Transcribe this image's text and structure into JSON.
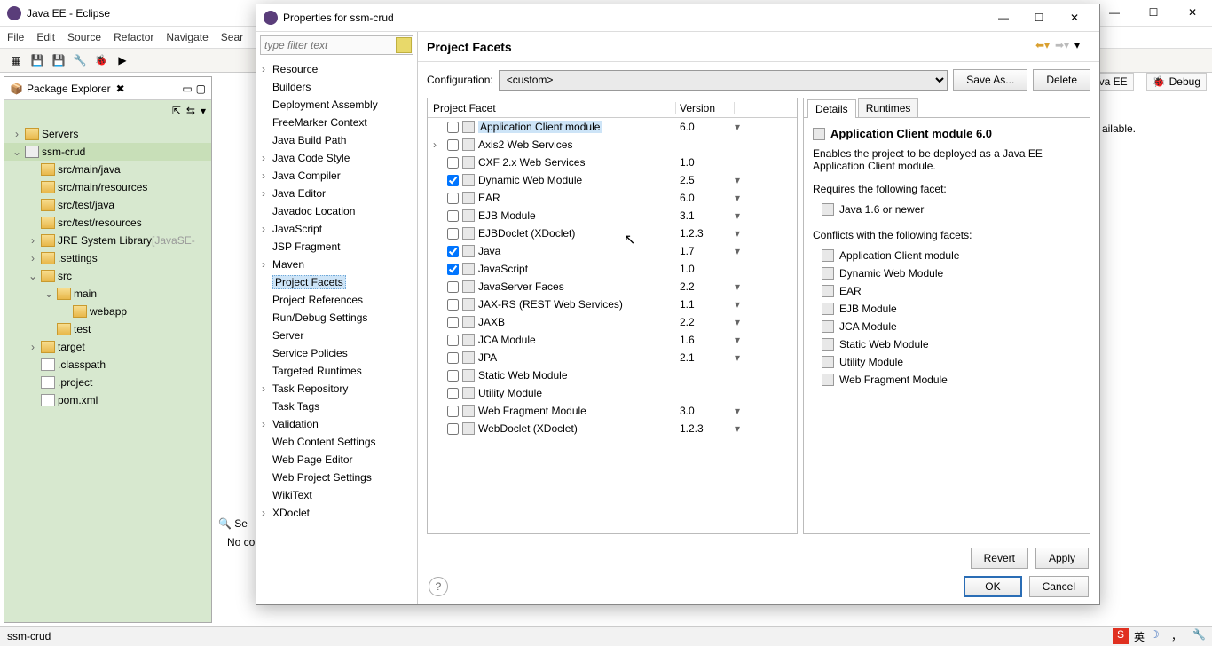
{
  "eclipse": {
    "title": "Java EE - Eclipse",
    "menubar": [
      "File",
      "Edit",
      "Source",
      "Refactor",
      "Navigate",
      "Sear"
    ],
    "status": "ssm-crud",
    "perspectives": {
      "javaee": "Java EE",
      "debug": "Debug"
    },
    "problems_msg": "No co",
    "problems_tab": "Se",
    "info_tail": "ailable."
  },
  "pkg": {
    "title": "Package Explorer",
    "tree": [
      {
        "label": "Servers",
        "depth": 0,
        "exp": ">",
        "icon": "folder"
      },
      {
        "label": "ssm-crud",
        "depth": 0,
        "exp": "v",
        "icon": "proj",
        "sel": true
      },
      {
        "label": "src/main/java",
        "depth": 1,
        "exp": "",
        "icon": "pkg"
      },
      {
        "label": "src/main/resources",
        "depth": 1,
        "exp": "",
        "icon": "pkg"
      },
      {
        "label": "src/test/java",
        "depth": 1,
        "exp": "",
        "icon": "pkg"
      },
      {
        "label": "src/test/resources",
        "depth": 1,
        "exp": "",
        "icon": "pkg"
      },
      {
        "label": "JRE System Library",
        "depth": 1,
        "exp": ">",
        "icon": "lib",
        "suffix": "[JavaSE-"
      },
      {
        "label": ".settings",
        "depth": 1,
        "exp": ">",
        "icon": "folder"
      },
      {
        "label": "src",
        "depth": 1,
        "exp": "v",
        "icon": "folder"
      },
      {
        "label": "main",
        "depth": 2,
        "exp": "v",
        "icon": "folder"
      },
      {
        "label": "webapp",
        "depth": 3,
        "exp": "",
        "icon": "folder"
      },
      {
        "label": "test",
        "depth": 2,
        "exp": "",
        "icon": "folder"
      },
      {
        "label": "target",
        "depth": 1,
        "exp": ">",
        "icon": "folder"
      },
      {
        "label": ".classpath",
        "depth": 1,
        "exp": "",
        "icon": "file"
      },
      {
        "label": ".project",
        "depth": 1,
        "exp": "",
        "icon": "file"
      },
      {
        "label": "pom.xml",
        "depth": 1,
        "exp": "",
        "icon": "file"
      }
    ]
  },
  "dialog": {
    "title": "Properties for ssm-crud",
    "filter_placeholder": "type filter text",
    "categories": [
      {
        "label": "Resource",
        "exp": ">"
      },
      {
        "label": "Builders"
      },
      {
        "label": "Deployment Assembly"
      },
      {
        "label": "FreeMarker Context"
      },
      {
        "label": "Java Build Path"
      },
      {
        "label": "Java Code Style",
        "exp": ">"
      },
      {
        "label": "Java Compiler",
        "exp": ">"
      },
      {
        "label": "Java Editor",
        "exp": ">"
      },
      {
        "label": "Javadoc Location"
      },
      {
        "label": "JavaScript",
        "exp": ">"
      },
      {
        "label": "JSP Fragment"
      },
      {
        "label": "Maven",
        "exp": ">"
      },
      {
        "label": "Project Facets",
        "sel": true
      },
      {
        "label": "Project References"
      },
      {
        "label": "Run/Debug Settings"
      },
      {
        "label": "Server"
      },
      {
        "label": "Service Policies"
      },
      {
        "label": "Targeted Runtimes"
      },
      {
        "label": "Task Repository",
        "exp": ">"
      },
      {
        "label": "Task Tags"
      },
      {
        "label": "Validation",
        "exp": ">"
      },
      {
        "label": "Web Content Settings"
      },
      {
        "label": "Web Page Editor"
      },
      {
        "label": "Web Project Settings"
      },
      {
        "label": "WikiText"
      },
      {
        "label": "XDoclet",
        "exp": ">"
      }
    ],
    "heading": "Project Facets",
    "config_label": "Configuration:",
    "config_value": "<custom>",
    "btn_saveas": "Save As...",
    "btn_delete": "Delete",
    "btn_revert": "Revert",
    "btn_apply": "Apply",
    "btn_ok": "OK",
    "btn_cancel": "Cancel",
    "table_head": {
      "c1": "Project Facet",
      "c2": "Version"
    },
    "facets": [
      {
        "label": "Application Client module",
        "ver": "6.0",
        "checked": false,
        "exp": "",
        "sel": true,
        "dd": true
      },
      {
        "label": "Axis2 Web Services",
        "ver": "",
        "checked": false,
        "exp": ">"
      },
      {
        "label": "CXF 2.x Web Services",
        "ver": "1.0",
        "checked": false
      },
      {
        "label": "Dynamic Web Module",
        "ver": "2.5",
        "checked": true,
        "dd": true
      },
      {
        "label": "EAR",
        "ver": "6.0",
        "checked": false,
        "dd": true
      },
      {
        "label": "EJB Module",
        "ver": "3.1",
        "checked": false,
        "dd": true
      },
      {
        "label": "EJBDoclet (XDoclet)",
        "ver": "1.2.3",
        "checked": false,
        "dd": true
      },
      {
        "label": "Java",
        "ver": "1.7",
        "checked": true,
        "dd": true
      },
      {
        "label": "JavaScript",
        "ver": "1.0",
        "checked": true
      },
      {
        "label": "JavaServer Faces",
        "ver": "2.2",
        "checked": false,
        "dd": true
      },
      {
        "label": "JAX-RS (REST Web Services)",
        "ver": "1.1",
        "checked": false,
        "dd": true
      },
      {
        "label": "JAXB",
        "ver": "2.2",
        "checked": false,
        "dd": true
      },
      {
        "label": "JCA Module",
        "ver": "1.6",
        "checked": false,
        "dd": true
      },
      {
        "label": "JPA",
        "ver": "2.1",
        "checked": false,
        "dd": true
      },
      {
        "label": "Static Web Module",
        "ver": "",
        "checked": false
      },
      {
        "label": "Utility Module",
        "ver": "",
        "checked": false
      },
      {
        "label": "Web Fragment Module",
        "ver": "3.0",
        "checked": false,
        "dd": true
      },
      {
        "label": "WebDoclet (XDoclet)",
        "ver": "1.2.3",
        "checked": false,
        "dd": true
      }
    ],
    "details": {
      "tab_details": "Details",
      "tab_runtimes": "Runtimes",
      "title": "Application Client module 6.0",
      "desc": "Enables the project to be deployed as a Java EE Application Client module.",
      "requires_label": "Requires the following facet:",
      "requires": [
        "Java 1.6 or newer"
      ],
      "conflicts_label": "Conflicts with the following facets:",
      "conflicts": [
        "Application Client module",
        "Dynamic Web Module",
        "EAR",
        "EJB Module",
        "JCA Module",
        "Static Web Module",
        "Utility Module",
        "Web Fragment Module"
      ]
    }
  }
}
